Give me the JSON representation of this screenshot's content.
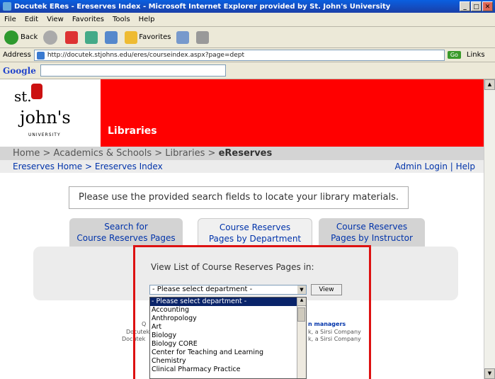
{
  "window": {
    "title": "Docutek ERes - Ereserves Index - Microsoft Internet Explorer provided by St. John's University"
  },
  "menu": [
    "File",
    "Edit",
    "View",
    "Favorites",
    "Tools",
    "Help"
  ],
  "toolbar": {
    "back": "Back",
    "favorites": "Favorites"
  },
  "address": {
    "label": "Address",
    "url": "http://docutek.stjohns.edu/eres/courseindex.aspx?page=dept",
    "go": "Go",
    "links": "Links"
  },
  "google": {
    "label": "Google"
  },
  "site": {
    "logo_st": "st.",
    "logo_johns": "john's",
    "logo_univ": "UNIVERSITY",
    "library_title": "Libraries",
    "breadcrumb": {
      "path": "Home > Academics & Schools > Libraries > ",
      "current": "eReserves"
    },
    "subnav": {
      "left": "Ereserves Home > Ereserves Index",
      "admin": "Admin Login",
      "sep": "|",
      "help": "Help"
    },
    "notice": "Please use the provided search fields to locate your library materials.",
    "tabs": [
      {
        "line1": "Search for",
        "line2": "Course Reserves Pages"
      },
      {
        "line1": "Course Reserves",
        "line2": "Pages by Department"
      },
      {
        "line1": "Course Reserves",
        "line2": "Pages by Instructor"
      }
    ],
    "panel_label": "View List of Course Reserves Pages in:",
    "select_value": "- Please select department -",
    "view_button": "View",
    "dept_list": [
      "- Please select department -",
      "Accounting",
      "Anthropology",
      "Art",
      "Biology",
      "Biology CORE",
      "Center for Teaching and Learning",
      "Chemistry",
      "Clinical Pharmacy Practice"
    ],
    "footer": {
      "q": "Q",
      "docutek1": "Docutek",
      "docutek2": "Docutek",
      "managers": "n managers",
      "sirsi1": "k, a Sirsi Company",
      "sirsi2": "k, a Sirsi Company"
    }
  }
}
